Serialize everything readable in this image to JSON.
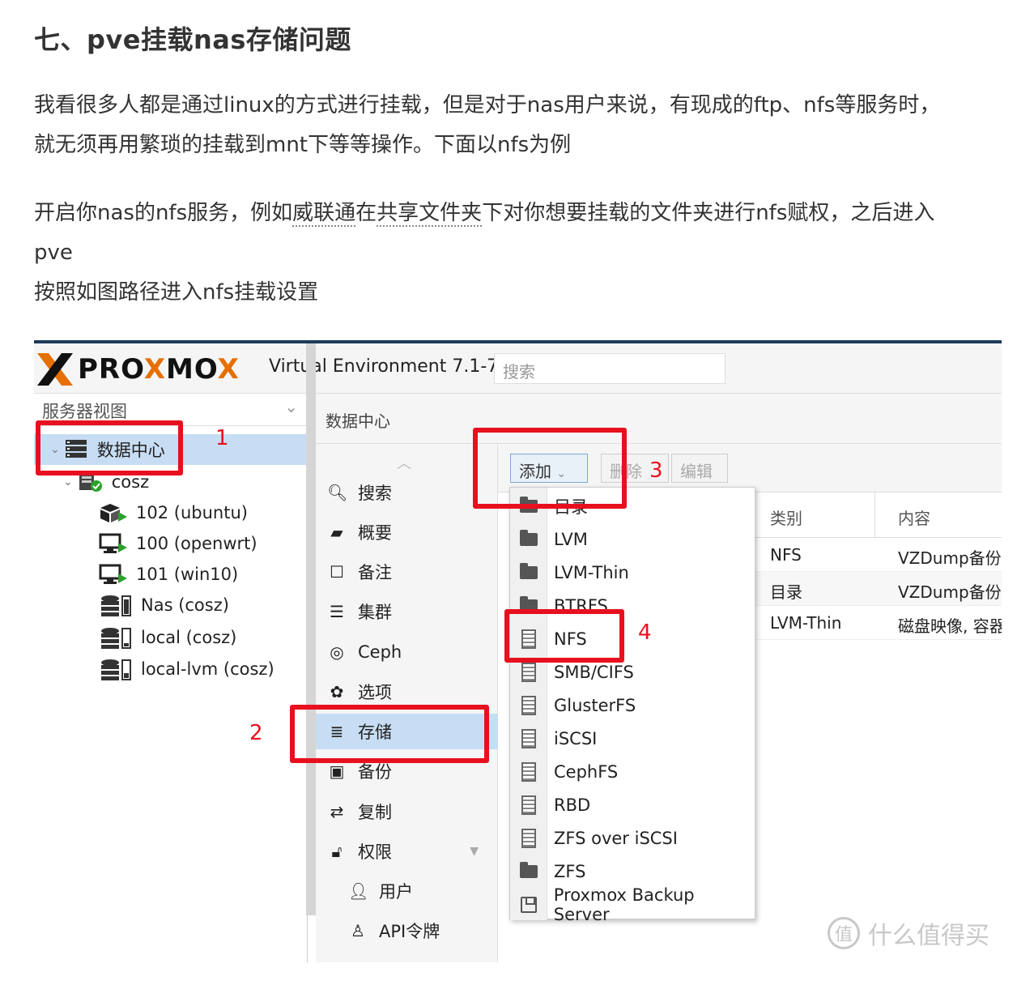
{
  "article": {
    "heading": "七、pve挂载nas存储问题",
    "para1_line1": "我看很多人都是通过linux的方式进行挂载，但是对于nas用户来说，有现成的ftp、nfs等服务时，",
    "para1_line2": "就无须再用繁琐的挂载到mnt下等等操作。下面以nfs为例",
    "para2_a": "开启你nas的nfs服务，例如",
    "para2_link1": "威联通",
    "para2_b": "在",
    "para2_link2": "共享文件夹",
    "para2_c": "下对你想要挂载的文件夹进行nfs赋权，之后进入",
    "para2_line2": "pve",
    "para3": "按照如图路径进入nfs挂载设置"
  },
  "screenshot": {
    "brand": "PROXMOX",
    "version_label": "Virtual Environment 7.1-7",
    "search_placeholder": "搜索",
    "tree": {
      "header": "服务器视图",
      "items": [
        {
          "label": "数据中心",
          "icon": "datacenter-icon"
        },
        {
          "label": "cosz",
          "icon": "node-icon"
        },
        {
          "label": "102 (ubuntu)",
          "icon": "container-icon"
        },
        {
          "label": "100 (openwrt)",
          "icon": "vm-icon"
        },
        {
          "label": "101 (win10)",
          "icon": "vm-icon"
        },
        {
          "label": "Nas (cosz)",
          "icon": "storage-icon"
        },
        {
          "label": "local (cosz)",
          "icon": "storage-icon"
        },
        {
          "label": "local-lvm (cosz)",
          "icon": "storage-icon"
        }
      ]
    },
    "panel_title": "数据中心",
    "nav": [
      {
        "label": "搜索",
        "icon": "search-icon"
      },
      {
        "label": "概要",
        "icon": "book-icon"
      },
      {
        "label": "备注",
        "icon": "note-icon"
      },
      {
        "label": "集群",
        "icon": "cluster-icon"
      },
      {
        "label": "Ceph",
        "icon": "ceph-icon"
      },
      {
        "label": "选项",
        "icon": "gear-icon"
      },
      {
        "label": "存储",
        "icon": "database-icon"
      },
      {
        "label": "备份",
        "icon": "floppy-icon"
      },
      {
        "label": "复制",
        "icon": "retweet-icon"
      },
      {
        "label": "权限",
        "icon": "unlock-icon"
      },
      {
        "label": "用户",
        "icon": "user-icon"
      },
      {
        "label": "API令牌",
        "icon": "user-outline-icon"
      }
    ],
    "toolbar": {
      "add": "添加",
      "delete": "删除",
      "edit": "编辑"
    },
    "grid": {
      "columns": [
        "类别",
        "内容"
      ],
      "rows": [
        [
          "NFS",
          "VZDump备份"
        ],
        [
          "目录",
          "VZDump备份"
        ],
        [
          "LVM-Thin",
          "磁盘映像, 容器"
        ]
      ]
    },
    "add_menu": [
      {
        "label": "目录",
        "icon": "folder-icon"
      },
      {
        "label": "LVM",
        "icon": "folder-icon"
      },
      {
        "label": "LVM-Thin",
        "icon": "folder-icon"
      },
      {
        "label": "BTRFS",
        "icon": "folder-icon"
      },
      {
        "label": "NFS",
        "icon": "server-icon"
      },
      {
        "label": "SMB/CIFS",
        "icon": "server-icon"
      },
      {
        "label": "GlusterFS",
        "icon": "server-icon"
      },
      {
        "label": "iSCSI",
        "icon": "server-icon"
      },
      {
        "label": "CephFS",
        "icon": "server-icon"
      },
      {
        "label": "RBD",
        "icon": "server-icon"
      },
      {
        "label": "ZFS over iSCSI",
        "icon": "server-icon"
      },
      {
        "label": "ZFS",
        "icon": "folder-icon"
      },
      {
        "label": "Proxmox Backup Server",
        "icon": "floppy-icon"
      }
    ],
    "annotations": [
      "1",
      "2",
      "3",
      "4"
    ],
    "annotation_color": "#e8101e"
  },
  "watermark": "什么值得买",
  "watermark_mark": "值"
}
